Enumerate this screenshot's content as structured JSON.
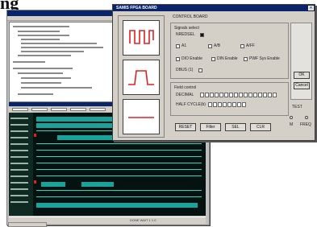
{
  "heading": "ng",
  "dialog": {
    "title": "SAMIS FPGA BOARD",
    "close_glyph": "×",
    "control_board_label": "CONTROL BOARD",
    "signals_label": "Signals select",
    "signal_checkbox_1": "NREDSEL",
    "options": [
      "A1",
      "A/B",
      "A/FF",
      "DIO Enable",
      "DIN Enable",
      "PWF Sys Enable"
    ],
    "bit_label": "DBUS (1)",
    "field_control_label": "Field control",
    "decimal_label": "DECIMAL",
    "half_cycle_label": "HALF CYCLE(b)",
    "buttons": {
      "reset": "RESET",
      "filter": "Filter",
      "sel": "SEL",
      "clear": "CLR"
    },
    "ok_label": "OK",
    "cancel_label": "Cancel",
    "test_label": "TEST",
    "radio_left": "M",
    "radio_right": "FREQ"
  },
  "back_window": {
    "status_text": "DONE  WAIT 1 1.0"
  },
  "icons": [
    "square-wave-icon",
    "pulse-wave-icon",
    "flat-line-icon",
    "close-icon"
  ],
  "colors": {
    "title_bar": "#0a246a",
    "wave_bg": "#04130f",
    "trace": "#2fd3c4",
    "waveform_red": "#e02020"
  }
}
